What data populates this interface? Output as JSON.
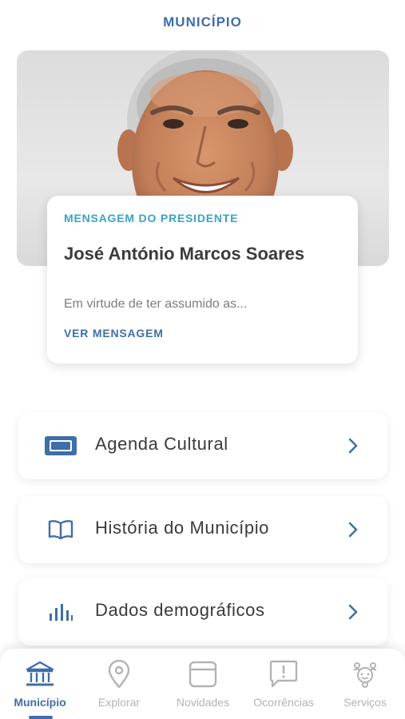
{
  "header": {
    "title": "MUNICÍPIO"
  },
  "president_card": {
    "eyebrow": "MENSAGEM DO PRESIDENTE",
    "name": "José António Marcos Soares",
    "excerpt": "Em virtude de ter assumido as...",
    "link_label": "VER MENSAGEM"
  },
  "menu": {
    "items": [
      {
        "label": "Agenda Cultural",
        "icon": "ticket-icon"
      },
      {
        "label": "História do Município",
        "icon": "book-icon"
      },
      {
        "label": "Dados demográficos",
        "icon": "bar-chart-icon"
      }
    ]
  },
  "bottom_nav": {
    "active": "Município",
    "items": [
      {
        "label": "Município",
        "icon": "town-hall-icon"
      },
      {
        "label": "Explorar",
        "icon": "map-pin-icon"
      },
      {
        "label": "Novidades",
        "icon": "news-card-icon"
      },
      {
        "label": "Ocorrências",
        "icon": "alert-chat-icon"
      },
      {
        "label": "Serviços",
        "icon": "services-icon"
      }
    ]
  },
  "colors": {
    "primary": "#3f6ea8",
    "accent": "#3aa3c4",
    "text_dark": "#3a3a3a",
    "text_muted": "#7d7d7d",
    "nav_inactive": "#b3b3b3"
  }
}
